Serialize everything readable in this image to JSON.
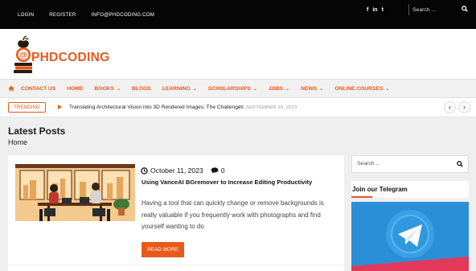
{
  "topbar": {
    "links": [
      "LOGIN",
      "REGISTER",
      "INFO@PHDCODING.COM"
    ],
    "social": [
      "f",
      "in",
      "t"
    ],
    "search_placeholder": "Search ..."
  },
  "header": {
    "brand": "PHDCODING"
  },
  "nav": {
    "items": [
      {
        "label": "CONTACT US"
      },
      {
        "label": "HOME"
      },
      {
        "label": "BOOKS"
      },
      {
        "label": "BLOGS"
      },
      {
        "label": "LEARNING"
      },
      {
        "label": "SCHOLARSHIPS"
      },
      {
        "label": "JOBS"
      },
      {
        "label": "NEWS"
      },
      {
        "label": "ONLINE COURSES"
      }
    ]
  },
  "trending": {
    "badge": "TRENDING",
    "title": "Translating Architectural Vision into 3D Rendered Images: The Challenges",
    "date": "SEPTEMBER 29, 2023"
  },
  "page": {
    "title": "Latest Posts",
    "breadcrumb": "Home"
  },
  "post": {
    "date": "October 11, 2023",
    "comments": "0",
    "title": "Using VanceAI BGremover to Increase Editing Productivity",
    "excerpt": "Having a tool that can quickly change or remove backgrounds is really valuable if you frequently work with photographs and find yourself wanting to do",
    "read_more": "READ MORE"
  },
  "sidebar": {
    "search_placeholder": "Search ...",
    "telegram_heading": "Join our Telegram"
  },
  "colors": {
    "accent": "#e8591a",
    "topbar_bg": "#050505",
    "telegram_blue": "#2b8fd8"
  }
}
